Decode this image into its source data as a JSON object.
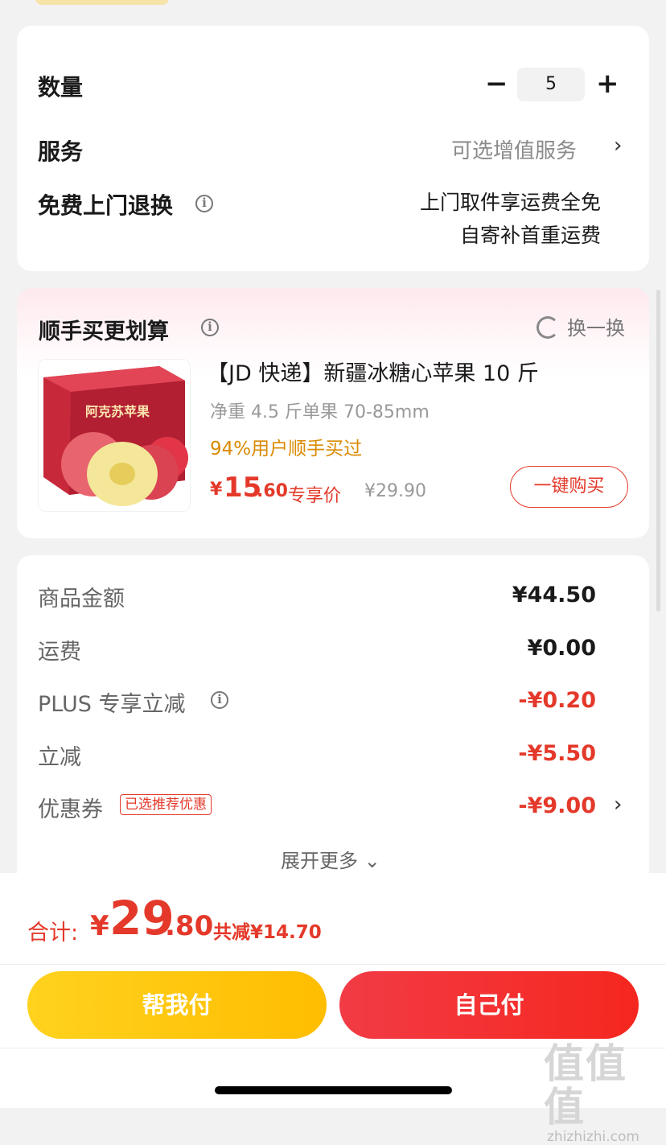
{
  "quantity": {
    "label": "数量",
    "minus": "−",
    "value": "5",
    "plus": "+"
  },
  "service": {
    "label": "服务",
    "value": "可选增值服务",
    "chevron": "›"
  },
  "return_service": {
    "label": "免费上门退换",
    "info": "i",
    "line1": "上门取件享运费全免",
    "line2": "自寄补首重运费"
  },
  "addon": {
    "title": "顺手买更划算",
    "info": "i",
    "swap_label": "换一换",
    "product": {
      "title": "【JD 快递】新疆冰糖心苹果 10 斤",
      "spec": "净重 4.5 斤单果 70-85mm",
      "tag": "94%用户顺手买过",
      "price_symbol": "¥",
      "price_int": "15",
      "price_dec": ".60",
      "price_label": "专享价",
      "original_price": "¥29.90",
      "buy_label": "一键购买",
      "image_text": "阿克苏苹果"
    }
  },
  "fees": {
    "goods_label": "商品金额",
    "goods_value": "¥44.50",
    "shipping_label": "运费",
    "shipping_value": "¥0.00",
    "plus_label": "PLUS 专享立减",
    "plus_value": "-¥0.20",
    "discount_label": "立减",
    "discount_value": "-¥5.50",
    "coupon_label": "优惠券",
    "coupon_tag": "已选推荐优惠",
    "coupon_value": "-¥9.00",
    "expand_label": "展开更多 ⌄"
  },
  "total": {
    "label": "合计:",
    "symbol": "¥",
    "int": "29",
    "dec": ".80",
    "saving": "共减¥14.70"
  },
  "buttons": {
    "help_pay": "帮我付",
    "self_pay": "自己付"
  },
  "watermark": {
    "chars": "值值值",
    "url": "zhizhizhi.com"
  },
  "colors": {
    "accent_red": "#e4392a",
    "tag_orange": "#d98a00",
    "help_yellow": "#ffc813"
  },
  "icons": [
    "info-icon",
    "chevron-right-icon",
    "refresh-icon",
    "minus-icon",
    "plus-icon",
    "chevron-down-icon"
  ]
}
